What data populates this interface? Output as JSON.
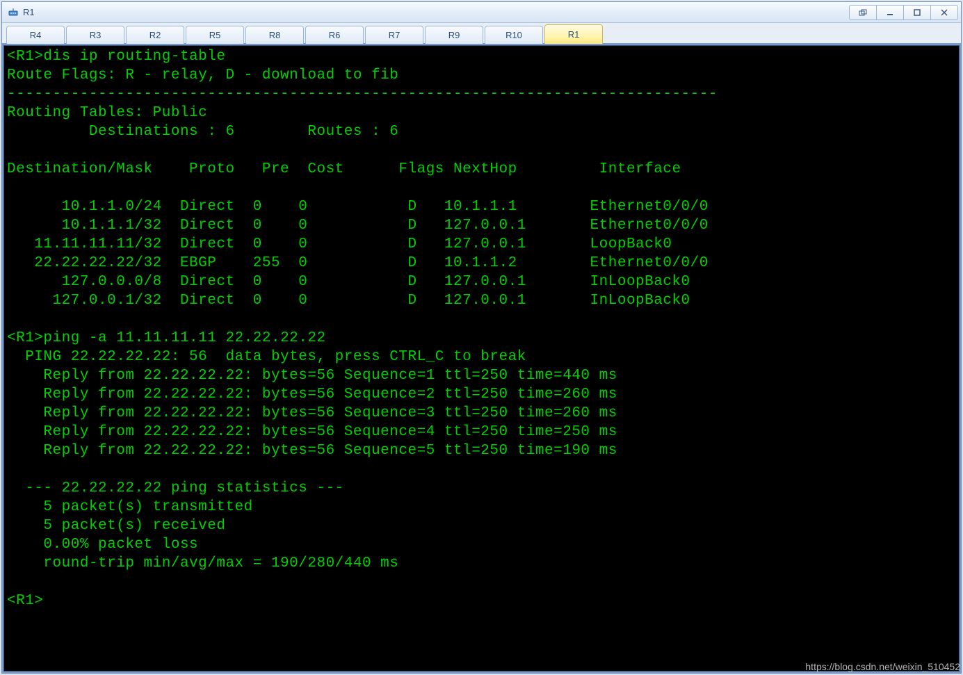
{
  "window": {
    "title": "R1"
  },
  "tabs": [
    {
      "label": "R4",
      "active": false
    },
    {
      "label": "R3",
      "active": false
    },
    {
      "label": "R2",
      "active": false
    },
    {
      "label": "R5",
      "active": false
    },
    {
      "label": "R8",
      "active": false
    },
    {
      "label": "R6",
      "active": false
    },
    {
      "label": "R7",
      "active": false
    },
    {
      "label": "R9",
      "active": false
    },
    {
      "label": "R10",
      "active": false
    },
    {
      "label": "R1",
      "active": true
    }
  ],
  "terminal": {
    "prompt": "<R1>",
    "cmd_routing": "dis ip routing-table",
    "route_flags_line": "Route Flags: R - relay, D - download to fib",
    "divider": "------------------------------------------------------------------------------",
    "routing_tables_line": "Routing Tables: Public",
    "dest_routes_line": "         Destinations : 6        Routes : 6",
    "header": "Destination/Mask    Proto   Pre  Cost      Flags NextHop         Interface",
    "routes": [
      "      10.1.1.0/24  Direct  0    0           D   10.1.1.1        Ethernet0/0/0",
      "      10.1.1.1/32  Direct  0    0           D   127.0.0.1       Ethernet0/0/0",
      "   11.11.11.11/32  Direct  0    0           D   127.0.0.1       LoopBack0",
      "   22.22.22.22/32  EBGP    255  0           D   10.1.1.2        Ethernet0/0/0",
      "      127.0.0.0/8  Direct  0    0           D   127.0.0.1       InLoopBack0",
      "     127.0.0.1/32  Direct  0    0           D   127.0.0.1       InLoopBack0"
    ],
    "cmd_ping": "ping -a 11.11.11.11 22.22.22.22",
    "ping_header": "  PING 22.22.22.22: 56  data bytes, press CTRL_C to break",
    "ping_replies": [
      "    Reply from 22.22.22.22: bytes=56 Sequence=1 ttl=250 time=440 ms",
      "    Reply from 22.22.22.22: bytes=56 Sequence=2 ttl=250 time=260 ms",
      "    Reply from 22.22.22.22: bytes=56 Sequence=3 ttl=250 time=260 ms",
      "    Reply from 22.22.22.22: bytes=56 Sequence=4 ttl=250 time=250 ms",
      "    Reply from 22.22.22.22: bytes=56 Sequence=5 ttl=250 time=190 ms"
    ],
    "ping_stats_header": "  --- 22.22.22.22 ping statistics ---",
    "ping_stats": [
      "    5 packet(s) transmitted",
      "    5 packet(s) received",
      "    0.00% packet loss",
      "    round-trip min/avg/max = 190/280/440 ms"
    ],
    "final_prompt": "<R1>"
  },
  "watermark": "https://blog.csdn.net/weixin_510452"
}
